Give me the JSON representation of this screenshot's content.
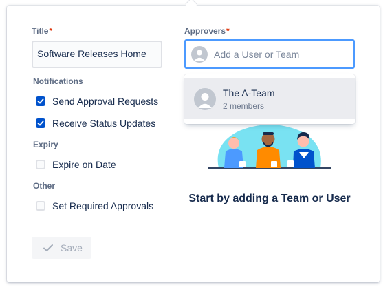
{
  "form": {
    "title_label": "Title",
    "required_mark": "*",
    "title_value": "Software Releases Home",
    "notifications_heading": "Notifications",
    "send_approval_label": "Send Approval Requests",
    "send_approval_checked": true,
    "receive_updates_label": "Receive Status Updates",
    "receive_updates_checked": true,
    "expiry_heading": "Expiry",
    "expire_label": "Expire on Date",
    "expire_checked": false,
    "other_heading": "Other",
    "required_approvals_label": "Set Required Approvals",
    "required_approvals_checked": false,
    "save_label": "Save"
  },
  "approvers": {
    "label": "Approvers",
    "placeholder": "Add a User or Team",
    "suggestions": [
      {
        "name": "The A-Team",
        "subtitle": "2 members",
        "icon": "user-avatar-icon"
      }
    ]
  },
  "empty_state": {
    "title": "Start by adding a Team or User",
    "illustration": "team-illustration"
  },
  "colors": {
    "primary": "#0052cc",
    "focus_border": "#4c9aff",
    "required": "#de350b",
    "text": "#172b4d",
    "subtle_text": "#5e6c84"
  }
}
